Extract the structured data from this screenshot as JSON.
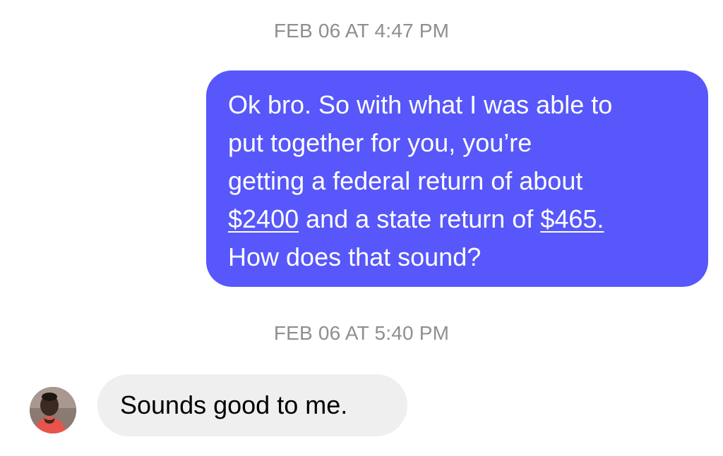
{
  "timestamps": {
    "first": "FEB 06 AT 4:47 PM",
    "second": "FEB 06 AT 5:40 PM"
  },
  "outgoing_message": {
    "line1": "Ok bro. So with what I was able to",
    "line2": "put together for you, you’re",
    "line3": "getting a federal return of about",
    "federal_amount": "$2400",
    "line4_middle": " and a state return of ",
    "state_amount": "$465.",
    "line5": "How does that sound?",
    "bubble_color": "#5757fb"
  },
  "incoming_message": {
    "text": "Sounds good to me.",
    "bubble_color": "#efefef",
    "avatar_icon": "user-avatar-photo"
  },
  "colors": {
    "timestamp": "#8e8e93",
    "background": "#ffffff"
  }
}
